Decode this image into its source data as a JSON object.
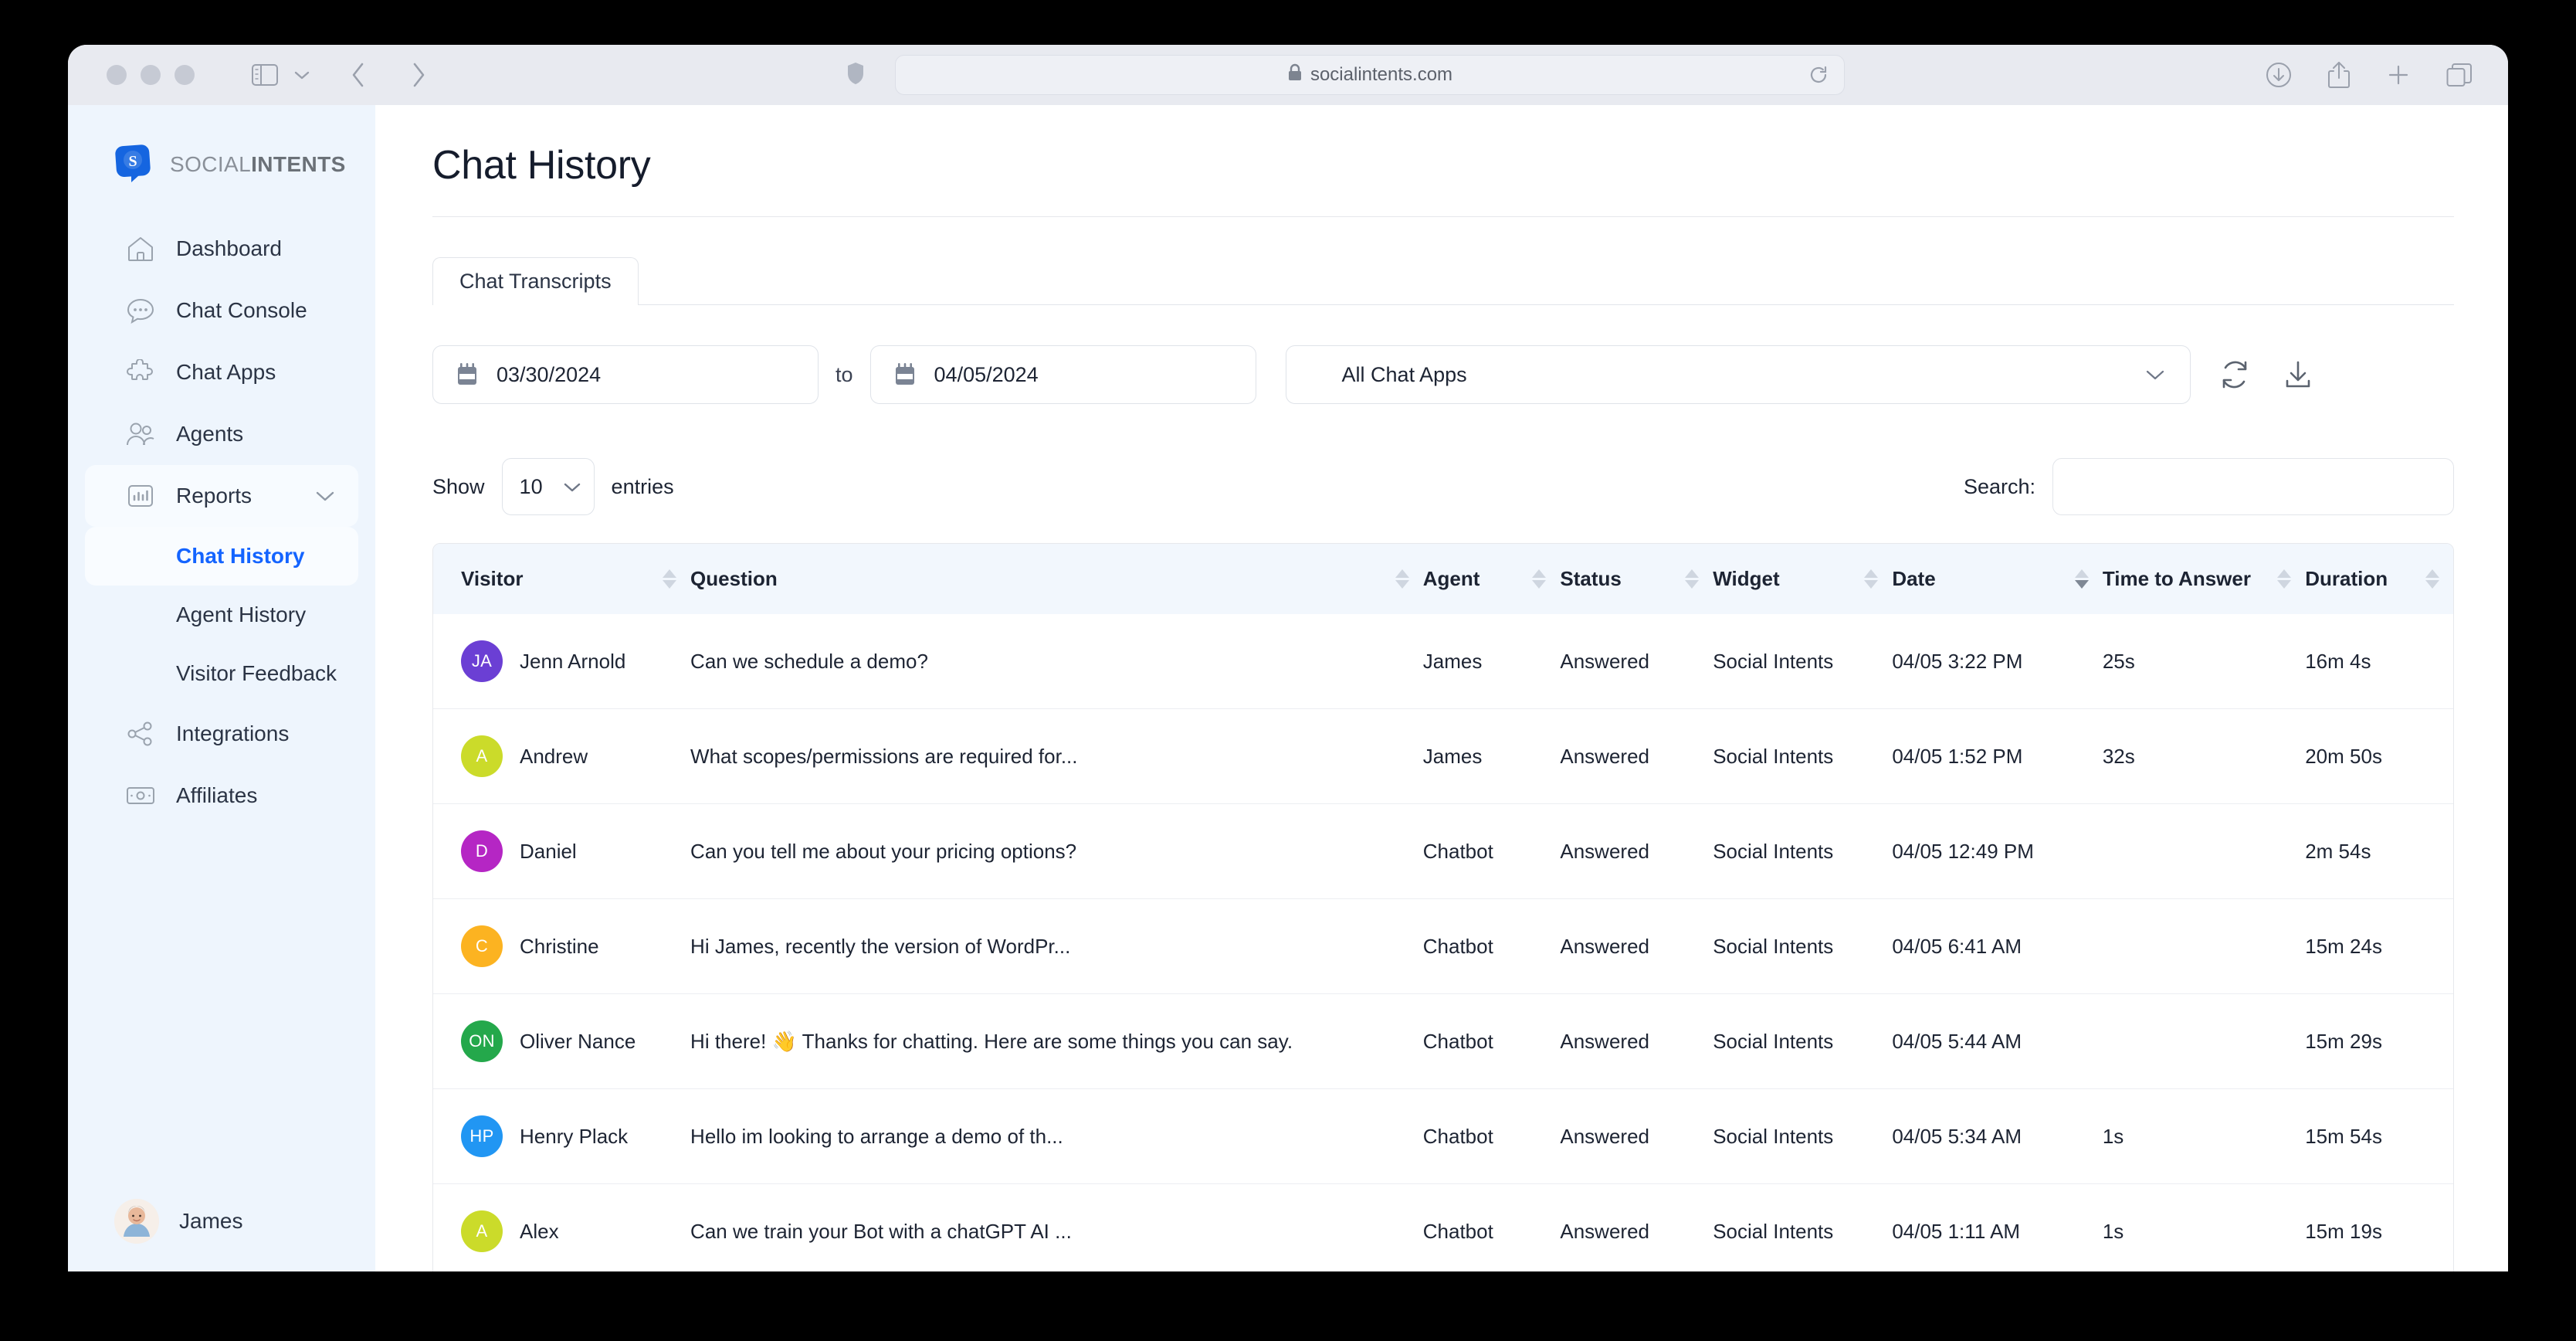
{
  "browser": {
    "url": "socialintents.com",
    "lock_icon": "lock-icon",
    "traffic_lights": [
      "close",
      "minimize",
      "maximize"
    ],
    "toolbar_icons": [
      "sidebar-toggle-icon",
      "chevron-down-icon",
      "back-arrow-icon",
      "forward-arrow-icon",
      "shield-icon",
      "reload-icon",
      "downloads-icon",
      "share-icon",
      "new-tab-icon",
      "tab-overview-icon"
    ]
  },
  "sidebar": {
    "logo": {
      "name_light": "SOCIAL",
      "name_bold": "INTENTS"
    },
    "items": [
      {
        "label": "Dashboard",
        "icon": "home-icon"
      },
      {
        "label": "Chat Console",
        "icon": "chat-bubble-icon"
      },
      {
        "label": "Chat Apps",
        "icon": "puzzle-icon"
      },
      {
        "label": "Agents",
        "icon": "users-icon"
      },
      {
        "label": "Reports",
        "icon": "bar-chart-icon",
        "expanded": true
      },
      {
        "label": "Integrations",
        "icon": "share-nodes-icon"
      },
      {
        "label": "Affiliates",
        "icon": "money-icon"
      }
    ],
    "subitems": [
      {
        "label": "Chat History",
        "active": true
      },
      {
        "label": "Agent History",
        "active": false
      },
      {
        "label": "Visitor Feedback",
        "active": false
      }
    ],
    "user": {
      "name": "James"
    },
    "accent_color": "#1464ff",
    "background_color": "#eef5fd"
  },
  "page": {
    "title": "Chat History"
  },
  "tabs": [
    {
      "label": "Chat Transcripts",
      "active": true
    }
  ],
  "filters": {
    "date_from": "03/30/2024",
    "date_to": "04/05/2024",
    "to_label": "to",
    "chat_app": "All Chat Apps",
    "refresh_icon": "refresh-icon",
    "download_icon": "download-icon",
    "calendar_icon": "calendar-icon"
  },
  "table_controls": {
    "show_label": "Show",
    "entries_value": "10",
    "entries_label": "entries",
    "search_label": "Search:",
    "search_value": "",
    "search_placeholder": ""
  },
  "table": {
    "columns": [
      {
        "key": "visitor",
        "label": "Visitor",
        "sort": "none"
      },
      {
        "key": "question",
        "label": "Question",
        "sort": "none"
      },
      {
        "key": "agent",
        "label": "Agent",
        "sort": "none"
      },
      {
        "key": "status",
        "label": "Status",
        "sort": "none"
      },
      {
        "key": "widget",
        "label": "Widget",
        "sort": "none"
      },
      {
        "key": "date",
        "label": "Date",
        "sort": "desc"
      },
      {
        "key": "tta",
        "label": "Time to Answer",
        "sort": "none"
      },
      {
        "key": "duration",
        "label": "Duration",
        "sort": "none"
      }
    ],
    "rows": [
      {
        "initials": "JA",
        "avatar_color": "#6b3fd4",
        "visitor": "Jenn Arnold",
        "question": "Can we schedule a demo?",
        "agent": "James",
        "status": "Answered",
        "widget": "Social Intents",
        "date": "04/05 3:22 PM",
        "tta": "25s",
        "duration": "16m 4s"
      },
      {
        "initials": "A",
        "avatar_color": "#cbdb2a",
        "visitor": "Andrew",
        "question": "What scopes/permissions are required for...",
        "agent": "James",
        "status": "Answered",
        "widget": "Social Intents",
        "date": "04/05 1:52 PM",
        "tta": "32s",
        "duration": "20m 50s"
      },
      {
        "initials": "D",
        "avatar_color": "#b526c4",
        "visitor": "Daniel",
        "question": "Can you tell me about your pricing options?",
        "agent": "Chatbot",
        "status": "Answered",
        "widget": "Social Intents",
        "date": "04/05 12:49 PM",
        "tta": "",
        "duration": "2m 54s"
      },
      {
        "initials": "C",
        "avatar_color": "#fcb321",
        "visitor": "Christine",
        "question": "Hi James, recently the version of WordPr...",
        "agent": "Chatbot",
        "status": "Answered",
        "widget": "Social Intents",
        "date": "04/05 6:41 AM",
        "tta": "",
        "duration": "15m 24s"
      },
      {
        "initials": "ON",
        "avatar_color": "#24a84b",
        "visitor": "Oliver Nance",
        "question": "Hi there! 👋 Thanks for chatting. Here are some things you can say.",
        "agent": "Chatbot",
        "status": "Answered",
        "widget": "Social Intents",
        "date": "04/05 5:44 AM",
        "tta": "",
        "duration": "15m 29s"
      },
      {
        "initials": "HP",
        "avatar_color": "#2196f3",
        "visitor": "Henry Plack",
        "question": "Hello im looking to arrange a demo of th...",
        "agent": "Chatbot",
        "status": "Answered",
        "widget": "Social Intents",
        "date": "04/05 5:34 AM",
        "tta": "1s",
        "duration": "15m 54s"
      },
      {
        "initials": "A",
        "avatar_color": "#cbdb2a",
        "visitor": "Alex",
        "question": "Can we train your Bot with a chatGPT AI ...",
        "agent": "Chatbot",
        "status": "Answered",
        "widget": "Social Intents",
        "date": "04/05 1:11 AM",
        "tta": "1s",
        "duration": "15m 19s"
      }
    ]
  }
}
